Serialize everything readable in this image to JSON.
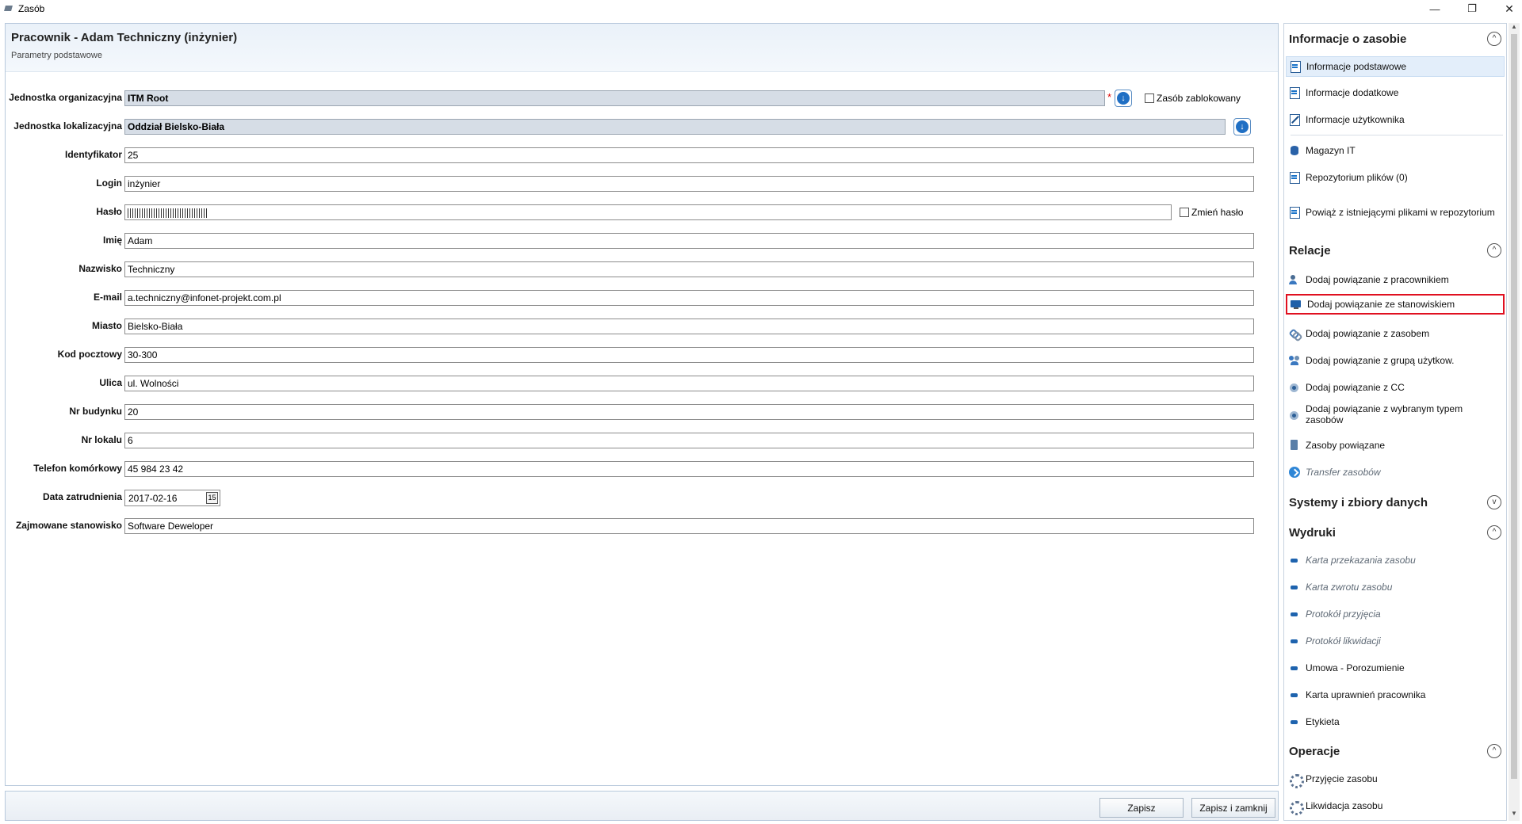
{
  "window": {
    "title": "Zasób",
    "min_glyph": "—",
    "max_glyph": "❐",
    "close_glyph": "✕"
  },
  "header": {
    "title": "Pracownik - Adam Techniczny (inżynier)",
    "subtitle": "Parametry podstawowe"
  },
  "form": {
    "org_unit": {
      "label": "Jednostka organizacyjna",
      "value": "ITM Root",
      "required_mark": "*"
    },
    "locked": {
      "label": "Zasób zablokowany",
      "checked": false
    },
    "loc_unit": {
      "label": "Jednostka lokalizacyjna",
      "value": "Oddział Bielsko-Biała"
    },
    "identifier": {
      "label": "Identyfikator",
      "value": "25"
    },
    "login": {
      "label": "Login",
      "value": "inżynier"
    },
    "password": {
      "label": "Hasło",
      "change_label": "Zmień hasło",
      "change_checked": false
    },
    "first_name": {
      "label": "Imię",
      "value": "Adam"
    },
    "last_name": {
      "label": "Nazwisko",
      "value": "Techniczny"
    },
    "email": {
      "label": "E-mail",
      "value": "a.techniczny@infonet-projekt.com.pl"
    },
    "city": {
      "label": "Miasto",
      "value": "Bielsko-Biała"
    },
    "postal_code": {
      "label": "Kod pocztowy",
      "value": "30-300"
    },
    "street": {
      "label": "Ulica",
      "value": "ul. Wolności"
    },
    "building_no": {
      "label": "Nr budynku",
      "value": "20"
    },
    "apartment_no": {
      "label": "Nr lokalu",
      "value": "6"
    },
    "mobile": {
      "label": "Telefon komórkowy",
      "value": "45 984 23 42"
    },
    "hire_date": {
      "label": "Data zatrudnienia",
      "value": "2017-02-16",
      "cal_glyph": "15"
    },
    "position": {
      "label": "Zajmowane stanowisko",
      "value": "Software Deweloper"
    }
  },
  "footer": {
    "save_label": "Zapisz",
    "save_close_label": "Zapisz i zamknij"
  },
  "side": {
    "sections": {
      "info": {
        "title": "Informacje o zasobie",
        "toggle": "^"
      },
      "relations": {
        "title": "Relacje",
        "toggle": "^"
      },
      "systems": {
        "title": "Systemy i zbiory danych",
        "toggle": "v"
      },
      "printouts": {
        "title": "Wydruki",
        "toggle": "^"
      },
      "operations": {
        "title": "Operacje",
        "toggle": "^"
      }
    },
    "info_items": [
      {
        "label": "Informacje podstawowe",
        "icon": "document-icon"
      },
      {
        "label": "Informacje dodatkowe",
        "icon": "document-icon"
      },
      {
        "label": "Informacje użytkownika",
        "icon": "edit-icon"
      },
      {
        "label": "Magazyn IT",
        "icon": "database-icon"
      },
      {
        "label": "Repozytorium plików (0)",
        "icon": "document-icon"
      },
      {
        "label": "Powiąż z istniejącymi plikami w repozytorium",
        "icon": "document-icon"
      }
    ],
    "relation_items": [
      {
        "label": "Dodaj powiązanie z pracownikiem",
        "icon": "user-icon"
      },
      {
        "label": "Dodaj powiązanie ze stanowiskiem",
        "icon": "workstation-icon"
      },
      {
        "label": "Dodaj powiązanie z zasobem",
        "icon": "link-icon"
      },
      {
        "label": "Dodaj powiązanie z grupą użytkow.",
        "icon": "group-icon"
      },
      {
        "label": "Dodaj powiązanie z CC",
        "icon": "share-icon"
      },
      {
        "label": "Dodaj powiązanie z wybranym typem zasobów",
        "icon": "share-icon"
      },
      {
        "label": "Zasoby powiązane",
        "icon": "box-icon"
      },
      {
        "label": "Transfer zasobów",
        "icon": "arrow-icon"
      }
    ],
    "print_items": [
      {
        "label": "Karta przekazania zasobu",
        "icon": "print-icon"
      },
      {
        "label": "Karta zwrotu zasobu",
        "icon": "print-icon"
      },
      {
        "label": "Protokół przyjęcia",
        "icon": "print-icon"
      },
      {
        "label": "Protokół likwidacji",
        "icon": "print-icon"
      },
      {
        "label": "Umowa - Porozumienie",
        "icon": "print-icon"
      },
      {
        "label": "Karta uprawnień pracownika",
        "icon": "print-icon"
      },
      {
        "label": "Etykieta",
        "icon": "print-icon"
      }
    ],
    "operation_items": [
      {
        "label": "Przyjęcie zasobu",
        "icon": "gear-icon"
      },
      {
        "label": "Likwidacja zasobu",
        "icon": "gear-icon"
      }
    ]
  }
}
